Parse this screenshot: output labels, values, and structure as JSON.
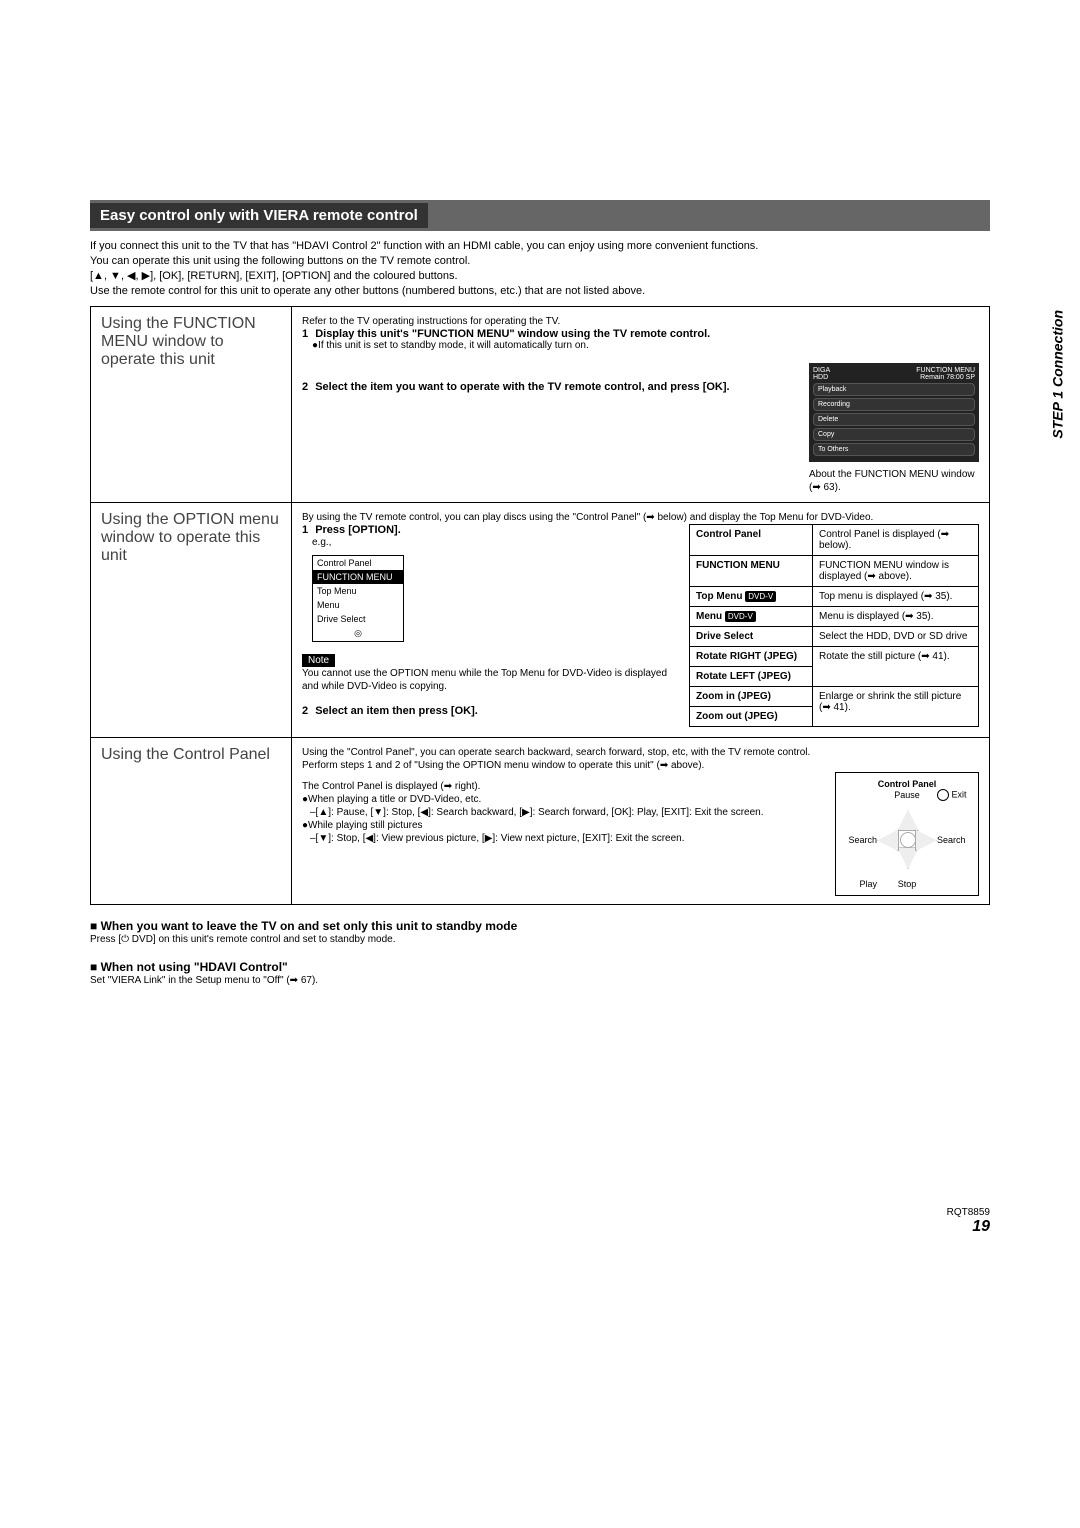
{
  "banner": {
    "title": "Easy control only with VIERA remote control"
  },
  "intro": {
    "l1": "If you connect this unit to the TV that has \"HDAVI Control 2\" function with an HDMI cable, you can enjoy using more convenient functions.",
    "l2": "You can operate this unit using the following buttons on the TV remote control.",
    "l3": "[▲, ▼, ◀, ▶], [OK], [RETURN], [EXIT], [OPTION] and the coloured buttons.",
    "l4": "Use the remote control for this unit to operate any other buttons (numbered buttons, etc.) that are not listed above."
  },
  "sec1": {
    "left": "Using the FUNCTION MENU window to operate this unit",
    "preline": "Refer to the TV operating instructions for operating the TV.",
    "s1_num": "1",
    "s1_title": "Display this unit's \"FUNCTION MENU\" window using the TV remote control.",
    "s1_b1": "●If this unit is set to standby mode, it will automatically turn on.",
    "s2_num": "2",
    "s2_title": "Select the item you want to operate with the TV remote control, and press [OK].",
    "tv": {
      "brand": "DIGA",
      "top": "FUNCTION MENU",
      "hdd": "HDD",
      "remain": "Remain  78:00 SP",
      "items": [
        "Playback",
        "Recording",
        "Delete",
        "Copy",
        "To Others"
      ]
    },
    "caption": "About the FUNCTION MENU window (➡ 63)."
  },
  "sec2": {
    "left": "Using the OPTION menu window to operate this unit",
    "preline": "By using the TV remote control, you can play discs using the \"Control Panel\" (➡ below) and display the Top Menu for DVD-Video.",
    "s1_num": "1",
    "s1_title": "Press [OPTION].",
    "eg": "e.g.,",
    "option_items": [
      "Control Panel",
      "FUNCTION MENU",
      "Top Menu",
      "Menu",
      "Drive Select"
    ],
    "note_label": "Note",
    "note_body": "You cannot use the OPTION menu while the Top Menu for DVD-Video is displayed and while DVD-Video is copying.",
    "s2_num": "2",
    "s2_title": "Select an item then press [OK]."
  },
  "table": {
    "rows": [
      {
        "k": "Control Panel",
        "tag": "",
        "v": "Control Panel is displayed (➡ below)."
      },
      {
        "k": "FUNCTION MENU",
        "tag": "",
        "v": "FUNCTION MENU window is displayed (➡ above)."
      },
      {
        "k": "Top Menu",
        "tag": "DVD-V",
        "v": "Top menu is displayed (➡ 35)."
      },
      {
        "k": "Menu",
        "tag": "DVD-V",
        "v": "Menu is displayed (➡ 35)."
      },
      {
        "k": "Drive Select",
        "tag": "",
        "v": "Select the HDD, DVD or SD drive"
      },
      {
        "k": "Rotate RIGHT (JPEG)",
        "tag": "",
        "v": "Rotate the still picture (➡ 41)."
      },
      {
        "k": "Rotate LEFT (JPEG)",
        "tag": "",
        "v": ""
      },
      {
        "k": "Zoom in (JPEG)",
        "tag": "",
        "v": "Enlarge or shrink the still picture (➡ 41)."
      },
      {
        "k": "Zoom out (JPEG)",
        "tag": "",
        "v": ""
      }
    ]
  },
  "sec3": {
    "left": "Using the Control Panel",
    "p1": "Using the \"Control Panel\", you can operate search backward, search forward, stop, etc, with the TV remote control.",
    "p2": "Perform steps 1 and 2 of \"Using the OPTION menu window to operate this unit\" (➡ above).",
    "disp": "The Control Panel is displayed (➡ right).",
    "b1": "●When playing a title or DVD-Video, etc.",
    "b1a": "–[▲]: Pause, [▼]: Stop, [◀]: Search backward, [▶]: Search forward, [OK]: Play, [EXIT]: Exit the screen.",
    "b2": "●While playing still pictures",
    "b2a": "–[▼]: Stop, [◀]: View previous picture, [▶]: View next picture, [EXIT]: Exit the screen.",
    "cp": {
      "title": "Control Panel",
      "pause": "Pause",
      "exit": "Exit",
      "search_l": "Search",
      "search_r": "Search",
      "play": "Play",
      "stop": "Stop"
    }
  },
  "notes": {
    "h1": "■ When you want to leave the TV on and set only this unit to standby mode",
    "t1": "Press [⏻ DVD] on this unit's remote control and set to standby mode.",
    "h2": "■ When not using \"HDAVI Control\"",
    "t2": "Set \"VIERA Link\" in the Setup menu to \"Off\" (➡ 67)."
  },
  "side": "STEP 1  Connection",
  "footer": {
    "code": "RQT8859",
    "page": "19"
  }
}
